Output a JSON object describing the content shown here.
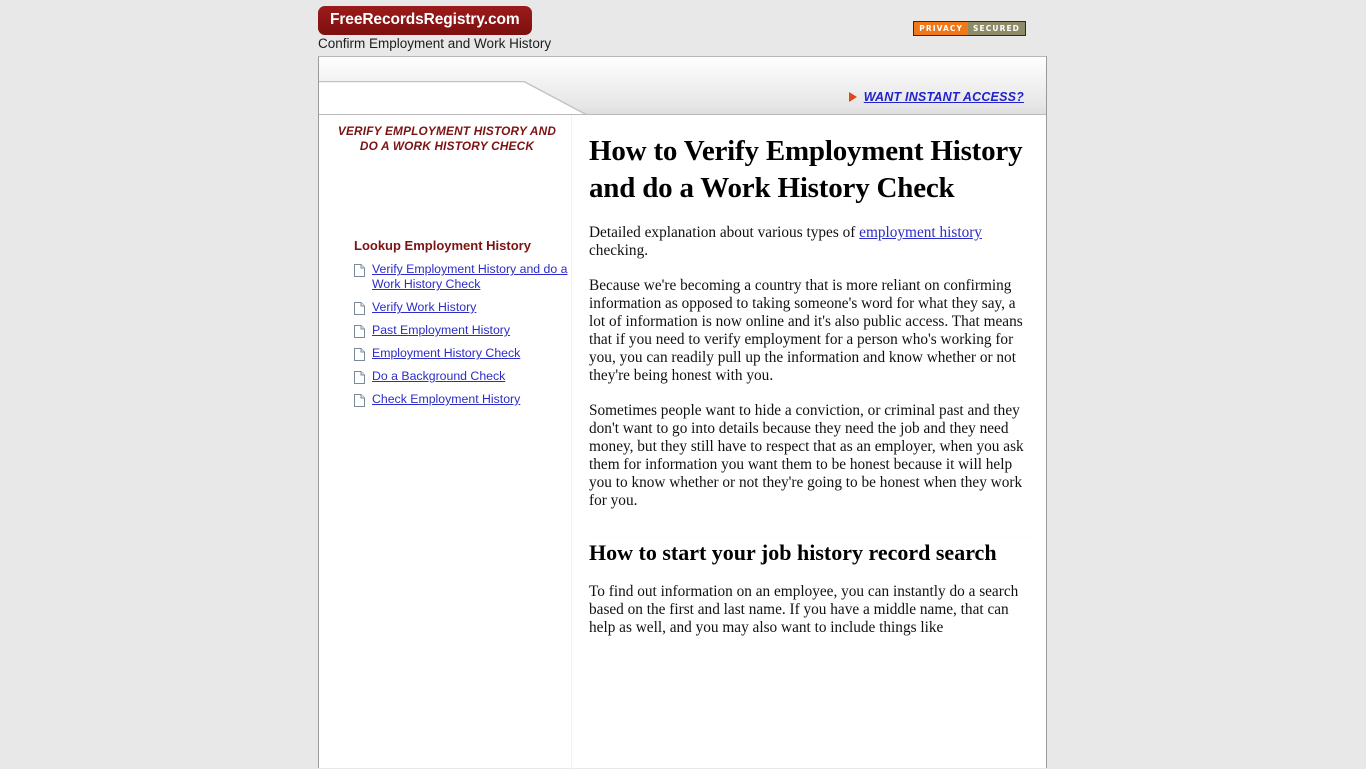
{
  "masthead": {
    "logo_text": "FreeRecordsRegistry.com",
    "tagline": "Confirm Employment and Work History",
    "privacy_badge": {
      "left_label": "PRIVACY",
      "right_label": "SECURED",
      "left_color": "#f07818",
      "right_color": "#8d8c67"
    }
  },
  "banner": {
    "instant_access_label": "WANT INSTANT ACCESS?",
    "arrow_icon": "triangle-right-icon",
    "arrow_color": "#e2471b",
    "link_color": "#2222cc"
  },
  "sidebar": {
    "title": "VERIFY EMPLOYMENT HISTORY AND DO A WORK HISTORY CHECK",
    "title_color": "#7d1212",
    "nav_heading": "Lookup Employment History",
    "items": [
      {
        "label": "Verify Employment History and do a Work History Check",
        "icon": "document-icon"
      },
      {
        "label": "Verify Work History",
        "icon": "document-icon"
      },
      {
        "label": "Past Employment History",
        "icon": "document-icon"
      },
      {
        "label": "Employment History Check",
        "icon": "document-icon"
      },
      {
        "label": "Do a Background Check",
        "icon": "document-icon"
      },
      {
        "label": "Check Employment History",
        "icon": "document-icon"
      }
    ]
  },
  "main": {
    "heading": "How to Verify Employment History and do a Work History Check",
    "intro_before_link": "Detailed explanation about various types of ",
    "intro_link": "employment history",
    "intro_after_link": " checking.",
    "paragraph_2": "Because we're becoming a country that is more reliant on confirming information as opposed to taking someone's word for what they say, a lot of information is now online and it's also public access. That means that if you need to verify employment for a person who's working for you, you can readily pull up the information and know whether or not they're being honest with you.",
    "paragraph_3": "Sometimes people want to hide a conviction, or criminal past and they don't want to go into details because they need the job and they need money, but they still have to respect that as an employer, when you ask them for information you want them to be honest because it will help you to know whether or not they're going to be honest when they work for you.",
    "section_heading": "How to start your job history record search",
    "paragraph_4": "To find out information on an employee, you can instantly do a search based on the first and last name. If you have a middle name, that can help as well, and you may also want to include things like"
  }
}
